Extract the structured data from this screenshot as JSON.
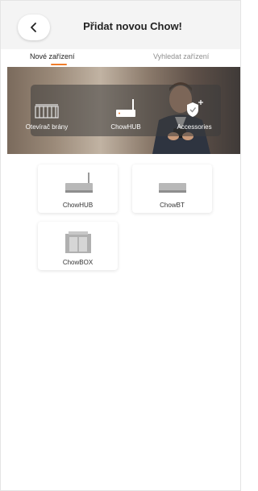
{
  "header": {
    "title": "Přidat novou Chow!",
    "back_icon": "chevron-left-icon"
  },
  "tabs": [
    {
      "label": "Nové zařízení",
      "active": true
    },
    {
      "label": "Vyhledat zařízení",
      "active": false
    }
  ],
  "colors": {
    "accent": "#f07d2a",
    "header_bg": "#f4f4f4"
  },
  "hero": {
    "categories": [
      {
        "label": "Otevírač brány",
        "icon": "gate-icon"
      },
      {
        "label": "ChowHUB",
        "icon": "hub-router-icon"
      },
      {
        "label": "Accessories",
        "icon": "shield-plus-icon"
      }
    ]
  },
  "devices": [
    {
      "label": "ChowHUB",
      "icon": "hub-router-icon"
    },
    {
      "label": "ChowBT",
      "icon": "bt-module-icon"
    },
    {
      "label": "ChowBOX",
      "icon": "box-icon"
    }
  ]
}
